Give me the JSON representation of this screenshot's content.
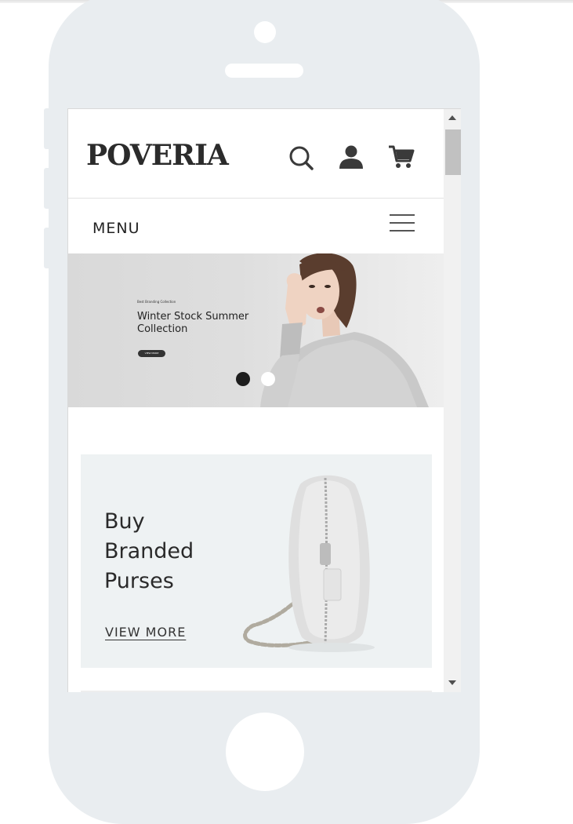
{
  "brand": {
    "logo": "POVERIA"
  },
  "header": {
    "icons": [
      "search-icon",
      "user-icon",
      "cart-icon"
    ]
  },
  "menu": {
    "label": "MENU"
  },
  "hero": {
    "subtitle": "Best Branding Collection",
    "title": "Winter Stock Summer Collection",
    "button_label": "VIEW MORE",
    "slide_count": 2,
    "active_slide": 1
  },
  "promo": {
    "title": "Buy Branded Purses",
    "link_label": "VIEW MORE"
  },
  "colors": {
    "device": "#e9edf0",
    "promo_bg": "#eef2f3",
    "text": "#2a2a2a"
  }
}
